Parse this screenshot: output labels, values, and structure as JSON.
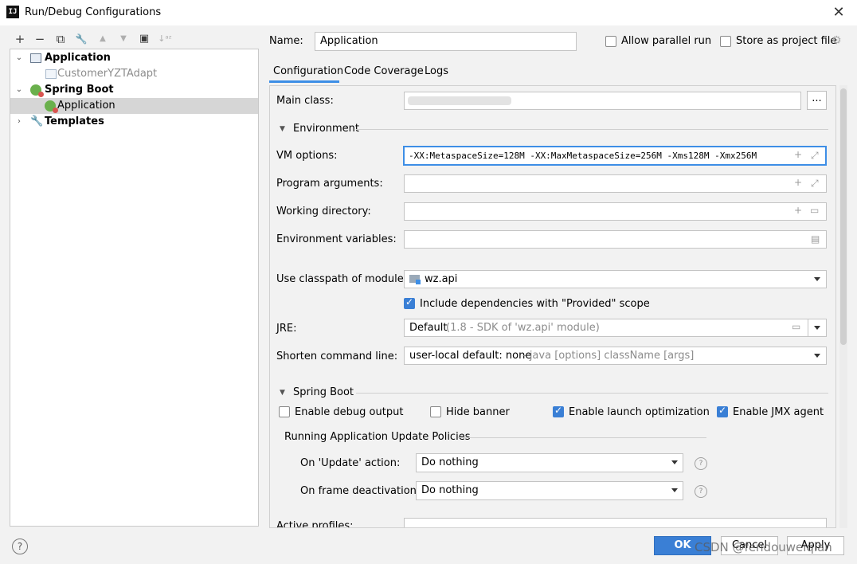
{
  "window": {
    "title": "Run/Debug Configurations",
    "app_icon_text": "IJ"
  },
  "toolbar": {
    "add": "+",
    "remove": "−",
    "copy": "⧉",
    "edit": "🔧",
    "up": "▲",
    "down": "▼",
    "folder": "▣",
    "sort": "↓ᵃᶻ"
  },
  "tree": {
    "application_group": "Application",
    "customer_item": "CustomerYZTAdapt",
    "spring_boot_group": "Spring Boot",
    "spring_app_item": "Application",
    "templates": "Templates"
  },
  "name_field": {
    "label": "Name:",
    "value": "Application"
  },
  "allow_parallel": {
    "label": "Allow parallel run",
    "checked": false
  },
  "store_project": {
    "label": "Store as project file",
    "checked": false
  },
  "tabs": [
    "Configuration",
    "Code Coverage",
    "Logs"
  ],
  "config": {
    "main_class_label": "Main class:",
    "main_class_btn": "...",
    "environment_header": "Environment",
    "vm_options_label": "VM options:",
    "vm_options_value": "-XX:MetaspaceSize=128M -XX:MaxMetaspaceSize=256M -Xms128M -Xmx256M",
    "program_args_label": "Program arguments:",
    "working_dir_label": "Working directory:",
    "env_vars_label": "Environment variables:",
    "classpath_label": "Use classpath of module:",
    "classpath_value": "wz.api",
    "include_deps_label": "Include dependencies with \"Provided\" scope",
    "jre_label": "JRE:",
    "jre_value": "Default",
    "jre_hint": "(1.8 - SDK of 'wz.api' module)",
    "shorten_label": "Shorten command line:",
    "shorten_value": "user-local default: none",
    "shorten_hint": "- java [options] className [args]",
    "spring_boot_header": "Spring Boot",
    "enable_debug_label": "Enable debug output",
    "hide_banner_label": "Hide banner",
    "launch_opt_label": "Enable launch optimization",
    "jmx_label": "Enable JMX agent",
    "policies_header": "Running Application Update Policies",
    "on_update_label": "On 'Update' action:",
    "on_update_value": "Do nothing",
    "on_frame_label": "On frame deactivation:",
    "on_frame_value": "Do nothing",
    "active_profiles_label": "Active profiles:"
  },
  "footer": {
    "help": "?",
    "ok": "OK",
    "cancel": "Cancel",
    "apply": "Apply",
    "watermark": "CSDN @fendouweiqian"
  },
  "colors": {
    "accent": "#3d8ee6",
    "ok_button": "#3a7fd5",
    "checkbox_on": "#3a7fd5"
  }
}
